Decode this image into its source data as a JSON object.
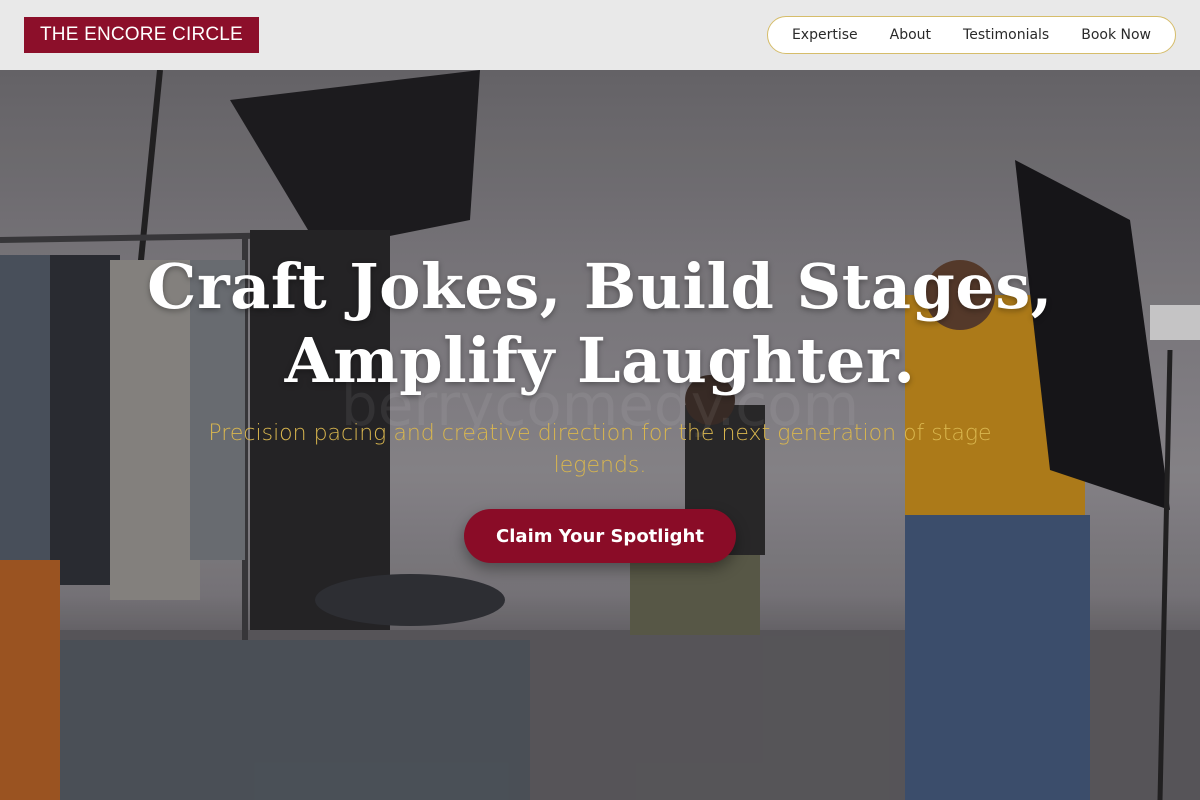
{
  "header": {
    "logo": "THE ENCORE CIRCLE",
    "nav": [
      "Expertise",
      "About",
      "Testimonials",
      "Book Now"
    ]
  },
  "hero": {
    "headline_line1": "Craft Jokes, Build Stages,",
    "headline_line2": "Amplify Laughter.",
    "subtitle": "Precision pacing and creative direction for the next generation of stage legends.",
    "cta": "Claim Your Spotlight",
    "watermark": "berrycomedy.com"
  },
  "colors": {
    "brand": "#8c0f2a",
    "accent_gold": "#d9b64e",
    "nav_border": "#d6bd6a"
  },
  "icons": [
    "studio-photo"
  ]
}
